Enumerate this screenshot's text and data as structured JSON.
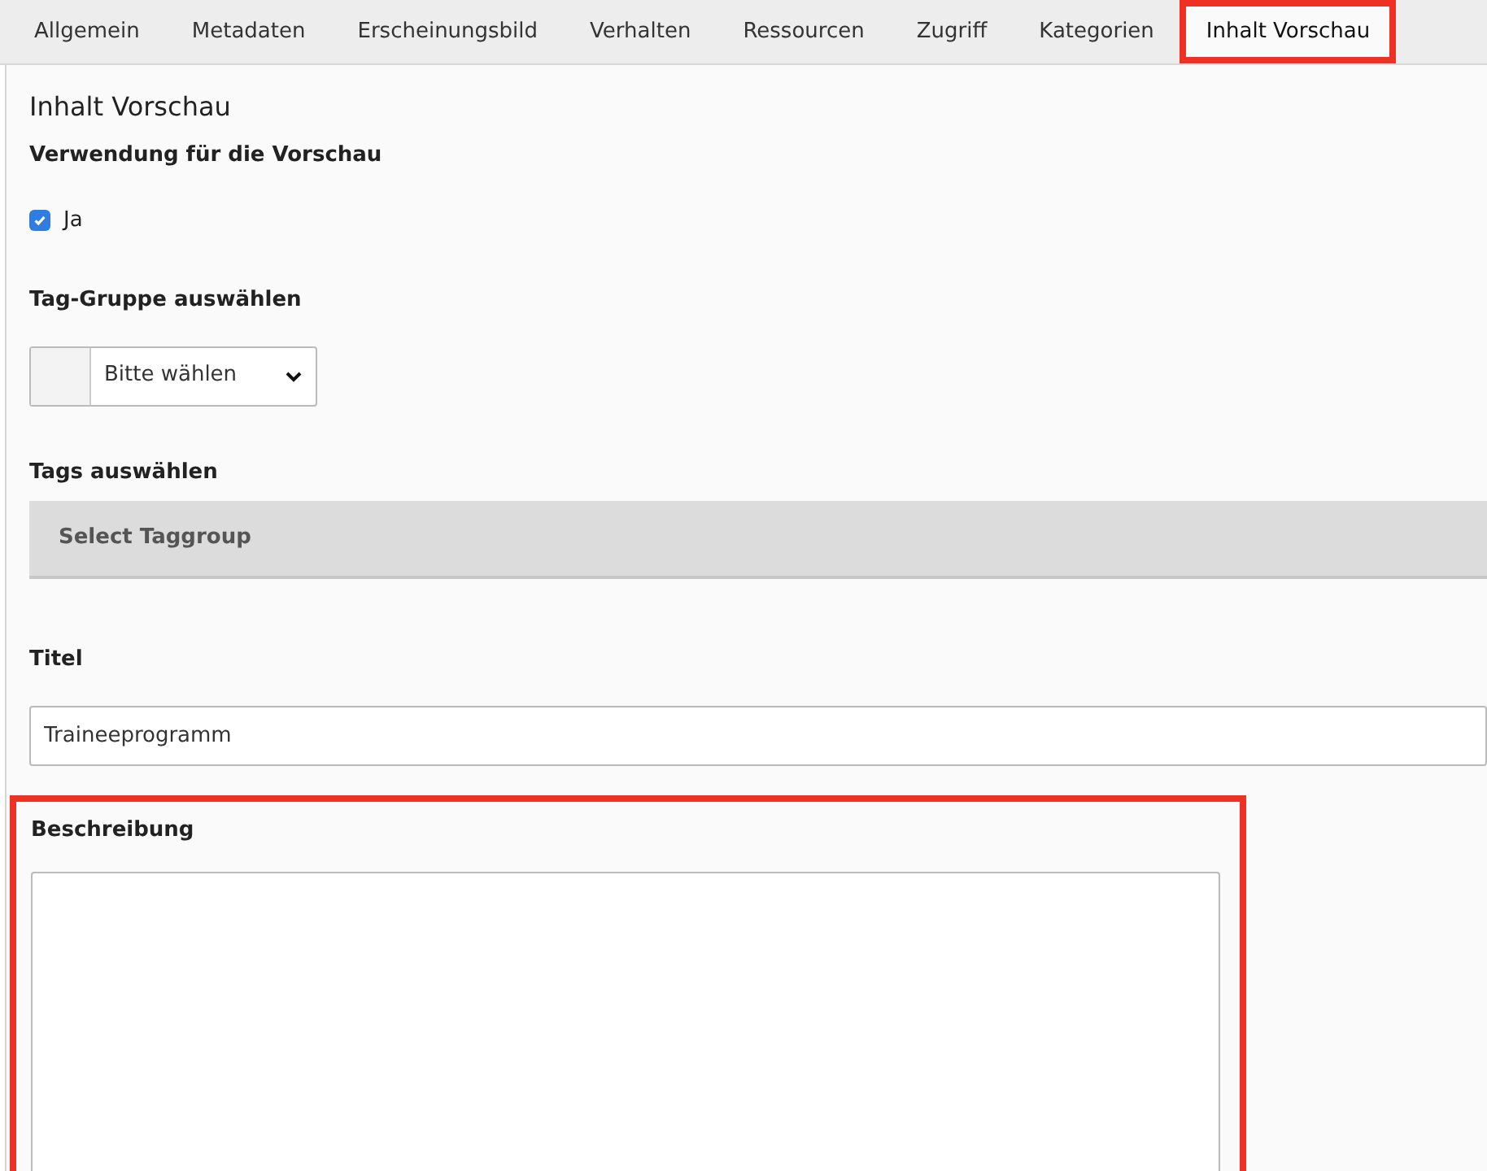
{
  "tabs": [
    {
      "label": "Allgemein",
      "selected": false,
      "highlighted": false
    },
    {
      "label": "Metadaten",
      "selected": false,
      "highlighted": false
    },
    {
      "label": "Erscheinungsbild",
      "selected": false,
      "highlighted": false
    },
    {
      "label": "Verhalten",
      "selected": false,
      "highlighted": false
    },
    {
      "label": "Ressourcen",
      "selected": false,
      "highlighted": false
    },
    {
      "label": "Zugriff",
      "selected": false,
      "highlighted": false
    },
    {
      "label": "Kategorien",
      "selected": false,
      "highlighted": false
    },
    {
      "label": "Inhalt Vorschau",
      "selected": true,
      "highlighted": true
    }
  ],
  "panel": {
    "title": "Inhalt Vorschau",
    "preview_usage": {
      "label": "Verwendung für die Vorschau",
      "option": "Ja",
      "checked": true
    },
    "tag_group": {
      "label": "Tag-Gruppe auswählen",
      "value": "Bitte wählen"
    },
    "tags": {
      "label": "Tags auswählen",
      "button": "Select Taggroup"
    },
    "title_field": {
      "label": "Titel",
      "value": "Traineeprogramm"
    },
    "description": {
      "label": "Beschreibung",
      "highlighted": true
    }
  }
}
